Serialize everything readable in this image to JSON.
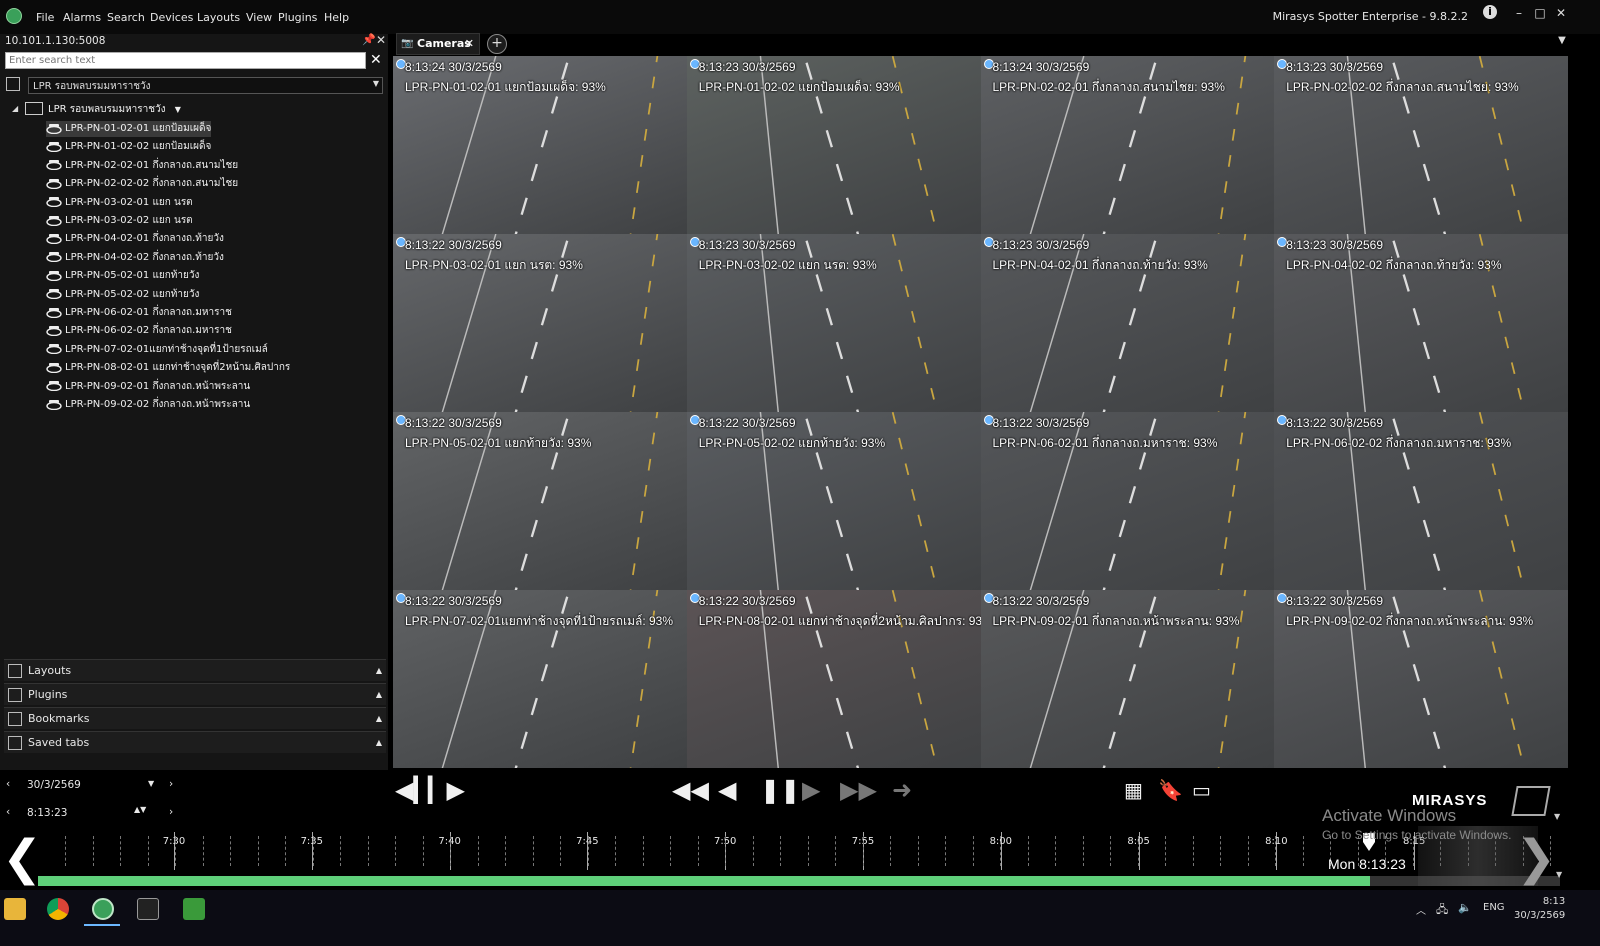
{
  "menu": {
    "items": [
      "File",
      "Alarms",
      "Search",
      "Devices",
      "Layouts",
      "View",
      "Plugins",
      "Help"
    ],
    "app_title": "Mirasys Spotter Enterprise - 9.8.2.2"
  },
  "left_panel": {
    "server": "10.101.1.130:5008",
    "search_placeholder": "Enter search text",
    "group_select": "LPR รอบพลบรมมหาราชวัง",
    "tree_root": "LPR รอบพลบรมมหาราชวัง",
    "cameras": [
      "LPR-PN-01-02-01 แยกป้อมเผด็จ",
      "LPR-PN-01-02-02 แยกป้อมเผด็จ",
      "LPR-PN-02-02-01 กึ่งกลางถ.สนามไชย",
      "LPR-PN-02-02-02 กึ่งกลางถ.สนามไชย",
      "LPR-PN-03-02-01 แยก นรต",
      "LPR-PN-03-02-02 แยก นรต",
      "LPR-PN-04-02-01 กึ่งกลางถ.ท้ายวัง",
      "LPR-PN-04-02-02 กึ่งกลางถ.ท้ายวัง",
      "LPR-PN-05-02-01 แยกท้ายวัง",
      "LPR-PN-05-02-02 แยกท้ายวัง",
      "LPR-PN-06-02-01 กึ่งกลางถ.มหาราช",
      "LPR-PN-06-02-02 กึ่งกลางถ.มหาราช",
      "LPR-PN-07-02-01แยกท่าช้างจุดที่1ป้ายรถเมล์",
      "LPR-PN-08-02-01 แยกท่าช้างจุดที่2หน้าม.ศิลปากร",
      "LPR-PN-09-02-01 กึ่งกลางถ.หน้าพระลาน",
      "LPR-PN-09-02-02 กึ่งกลางถ.หน้าพระลาน"
    ],
    "panels": [
      "Layouts",
      "Plugins",
      "Bookmarks",
      "Saved tabs"
    ]
  },
  "tabs": {
    "cameras": "Cameras",
    "add": "+"
  },
  "tiles": [
    {
      "time": "8:13:24  30/3/2569",
      "label": "LPR-PN-01-02-01 แยกป้อมเผด็จ: 93%"
    },
    {
      "time": "8:13:23  30/3/2569",
      "label": "LPR-PN-01-02-02 แยกป้อมเผด็จ: 93%"
    },
    {
      "time": "8:13:24  30/3/2569",
      "label": "LPR-PN-02-02-01 กึ่งกลางถ.สนามไชย: 93%"
    },
    {
      "time": "8:13:23  30/3/2569",
      "label": "LPR-PN-02-02-02 กึ่งกลางถ.สนามไชย: 93%"
    },
    {
      "time": "8:13:22  30/3/2569",
      "label": "LPR-PN-03-02-01 แยก นรต: 93%"
    },
    {
      "time": "8:13:23  30/3/2569",
      "label": "LPR-PN-03-02-02 แยก นรต: 93%"
    },
    {
      "time": "8:13:23  30/3/2569",
      "label": "LPR-PN-04-02-01 กึ่งกลางถ.ท้ายวัง: 93%"
    },
    {
      "time": "8:13:23  30/3/2569",
      "label": "LPR-PN-04-02-02 กึ่งกลางถ.ท้ายวัง: 93%"
    },
    {
      "time": "8:13:22  30/3/2569",
      "label": "LPR-PN-05-02-01 แยกท้ายวัง: 93%"
    },
    {
      "time": "8:13:22  30/3/2569",
      "label": "LPR-PN-05-02-02 แยกท้ายวัง: 93%"
    },
    {
      "time": "8:13:22  30/3/2569",
      "label": "LPR-PN-06-02-01 กึ่งกลางถ.มหาราช: 93%"
    },
    {
      "time": "8:13:22  30/3/2569",
      "label": "LPR-PN-06-02-02 กึ่งกลางถ.มหาราช: 93%"
    },
    {
      "time": "8:13:22  30/3/2569",
      "label": "LPR-PN-07-02-01แยกท่าช้างจุดที่1ป้ายรถเมล์: 93%"
    },
    {
      "time": "8:13:22  30/3/2569",
      "label": "LPR-PN-08-02-01 แยกท่าช้างจุดที่2หน้าม.ศิลปากร: 93"
    },
    {
      "time": "8:13:22  30/3/2569",
      "label": "LPR-PN-09-02-01 กึ่งกลางถ.หน้าพระลาน: 93%"
    },
    {
      "time": "8:13:22  30/3/2569",
      "label": "LPR-PN-09-02-02 กึ่งกลางถ.หน้าพระลาน: 93%"
    }
  ],
  "playback": {
    "date": "30/3/2569",
    "time": "8:13:23",
    "timeline_labels": [
      "7:30",
      "7:35",
      "7:40",
      "7:45",
      "7:50",
      "7:55",
      "8:00",
      "8:05",
      "8:10",
      "8:15"
    ],
    "current": "Mon 8:13:23",
    "progress": 0.876
  },
  "brand": "MIRASYS",
  "watermark": {
    "line1": "Activate Windows",
    "line2": "Go to Settings to activate Windows."
  },
  "taskbar": {
    "lang": "ENG",
    "clock_time": "8:13",
    "clock_date": "30/3/2569"
  }
}
